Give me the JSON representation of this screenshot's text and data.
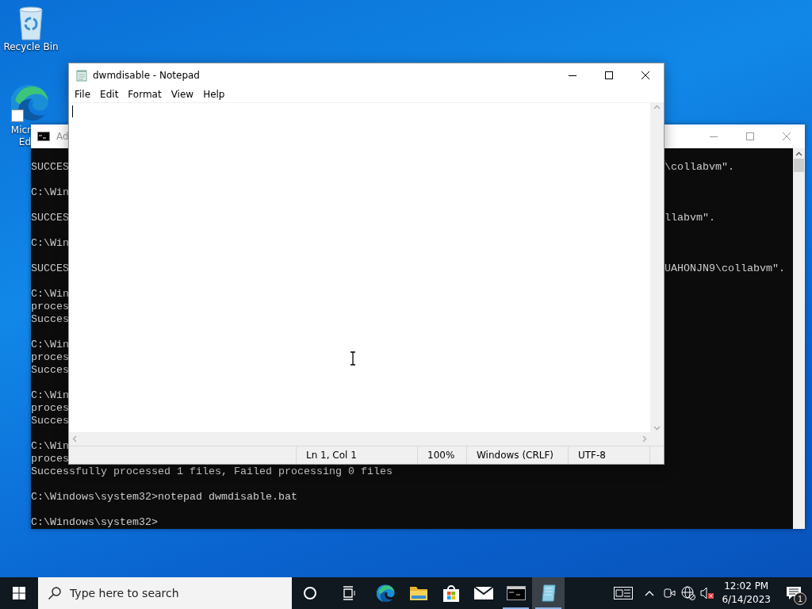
{
  "desktop": {
    "icons": [
      {
        "kind": "recycle-bin",
        "label_lines": [
          "Recycle Bin"
        ]
      },
      {
        "kind": "edge",
        "label_lines": [
          "Micr",
          "Ed"
        ]
      }
    ]
  },
  "console": {
    "title": "Ad",
    "lines": [
      {
        "kind": "text",
        "left": "SUCCES",
        "right": "\\collabvm\"."
      },
      {
        "kind": "blank"
      },
      {
        "kind": "text",
        "left": "C:\\Win"
      },
      {
        "kind": "blank"
      },
      {
        "kind": "text",
        "left": "SUCCES",
        "right": "llabvm\"."
      },
      {
        "kind": "blank"
      },
      {
        "kind": "text",
        "left": "C:\\Win"
      },
      {
        "kind": "blank"
      },
      {
        "kind": "text",
        "left": "SUCCES",
        "right": "UAHONJN9\\collabvm\"."
      },
      {
        "kind": "blank"
      },
      {
        "kind": "text",
        "left": "C:\\Win"
      },
      {
        "kind": "text",
        "left": "proces"
      },
      {
        "kind": "text",
        "left": "Succes"
      },
      {
        "kind": "blank"
      },
      {
        "kind": "text",
        "left": "C:\\Win"
      },
      {
        "kind": "text",
        "left": "proces"
      },
      {
        "kind": "text",
        "left": "Succes"
      },
      {
        "kind": "blank"
      },
      {
        "kind": "text",
        "left": "C:\\Win"
      },
      {
        "kind": "text",
        "left": "proces"
      },
      {
        "kind": "text",
        "left": "Succes"
      },
      {
        "kind": "blank"
      },
      {
        "kind": "text",
        "left": "C:\\Win"
      },
      {
        "kind": "text",
        "left": "proces"
      },
      {
        "kind": "text",
        "left": "Successfully processed 1 files, Failed processing 0 files"
      },
      {
        "kind": "blank"
      },
      {
        "kind": "text",
        "left": "C:\\Windows\\system32>notepad dwmdisable.bat"
      },
      {
        "kind": "blank"
      },
      {
        "kind": "text",
        "left": "C:\\Windows\\system32>"
      }
    ]
  },
  "notepad": {
    "title": "dwmdisable - Notepad",
    "menu": [
      "File",
      "Edit",
      "Format",
      "View",
      "Help"
    ],
    "status": [
      "Ln 1, Col 1",
      "100%",
      "Windows (CRLF)",
      "UTF-8"
    ]
  },
  "taskbar": {
    "search": {
      "placeholder": "Type here to search"
    },
    "apps": [
      {
        "kind": "edge",
        "running": false,
        "active": false
      },
      {
        "kind": "explorer",
        "running": false,
        "active": false
      },
      {
        "kind": "store",
        "running": false,
        "active": false
      },
      {
        "kind": "mail",
        "running": false,
        "active": false
      },
      {
        "kind": "console",
        "running": true,
        "active": false
      },
      {
        "kind": "notepad",
        "running": true,
        "active": true
      }
    ],
    "clock": {
      "time": "12:02 PM",
      "date": "6/14/2023"
    },
    "notifications": {
      "badge": "1"
    }
  }
}
